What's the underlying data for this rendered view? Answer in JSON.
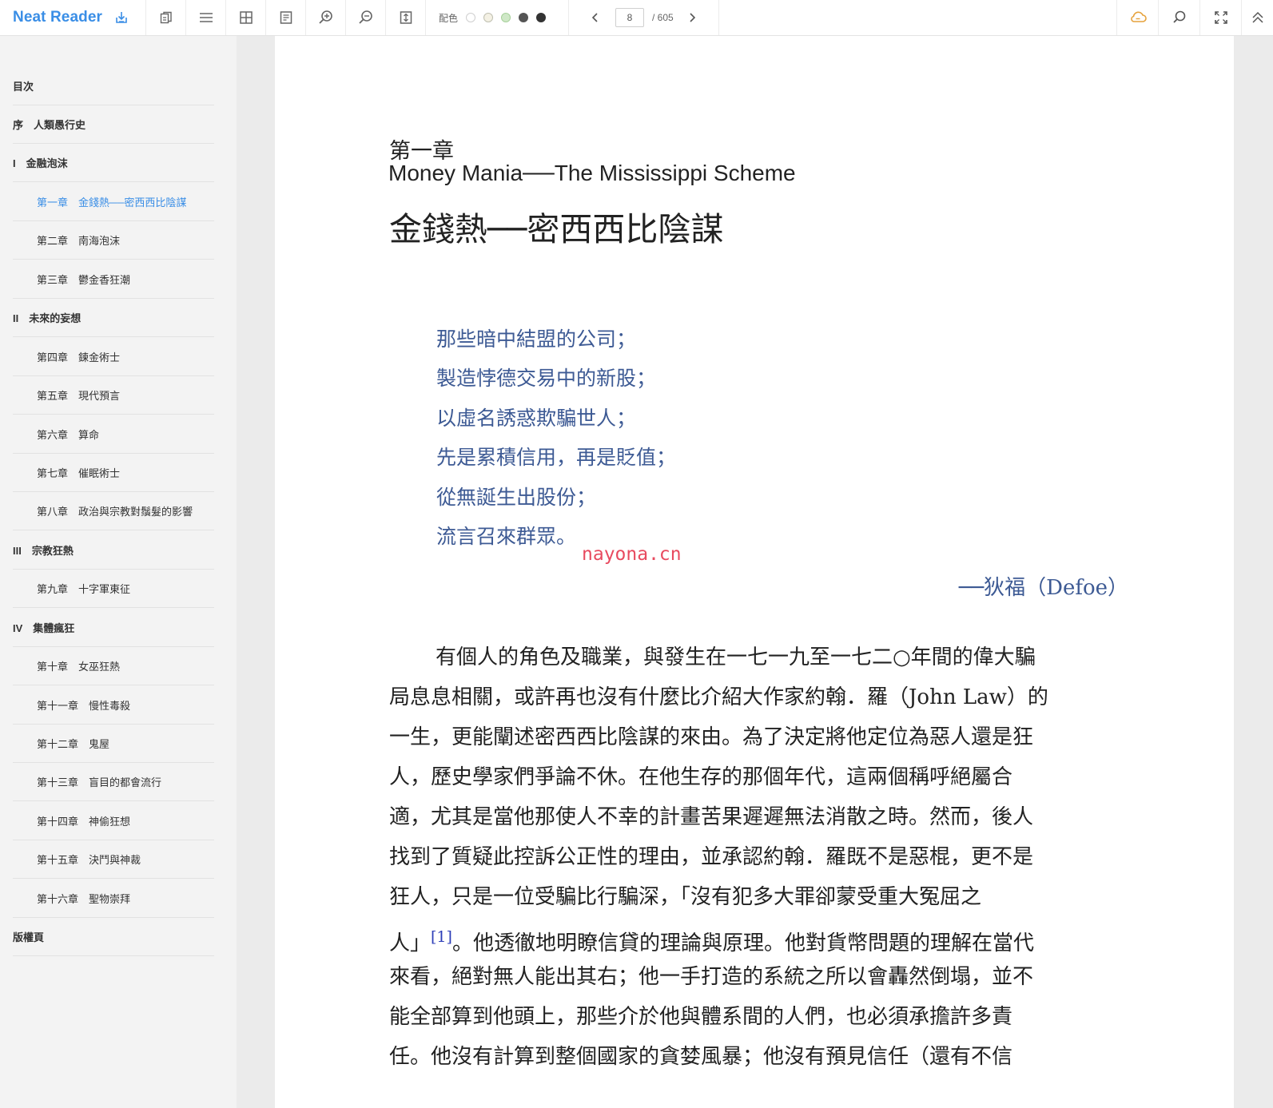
{
  "app": {
    "title": "Neat Reader",
    "accent_color": "#3a8ee6"
  },
  "toolbar": {
    "icons": [
      "import-icon",
      "copy-icon",
      "menu-icon",
      "grid-icon",
      "notes-icon",
      "zoom-in-icon",
      "zoom-out-icon",
      "fit-page-icon"
    ],
    "palette_label": "配色",
    "palette_colors": [
      "#ffffff",
      "#f4f1e4",
      "#cfe8c7",
      "#555555",
      "#333333"
    ],
    "page_current": "8",
    "page_total": "/ 605",
    "right_icons": [
      "cloud-sync-icon",
      "search-icon",
      "fullscreen-icon",
      "collapse-up-icon"
    ]
  },
  "toc": {
    "items": [
      {
        "label": "目次",
        "kind": "part"
      },
      {
        "label": "序　人類愚行史",
        "kind": "part"
      },
      {
        "label": "I　金融泡沫",
        "kind": "part"
      },
      {
        "label": "第一章　金錢熱──密西西比陰謀",
        "kind": "chapter",
        "active": true
      },
      {
        "label": "第二章　南海泡沫",
        "kind": "chapter"
      },
      {
        "label": "第三章　鬱金香狂潮",
        "kind": "chapter"
      },
      {
        "label": "II　未來的妄想",
        "kind": "part"
      },
      {
        "label": "第四章　鍊金術士",
        "kind": "chapter"
      },
      {
        "label": "第五章　現代預言",
        "kind": "chapter"
      },
      {
        "label": "第六章　算命",
        "kind": "chapter"
      },
      {
        "label": "第七章　催眠術士",
        "kind": "chapter"
      },
      {
        "label": "第八章　政治與宗教對鬚髮的影響",
        "kind": "chapter"
      },
      {
        "label": "III　宗教狂熱",
        "kind": "part"
      },
      {
        "label": "第九章　十字軍東征",
        "kind": "chapter"
      },
      {
        "label": "IV　集體瘋狂",
        "kind": "part"
      },
      {
        "label": "第十章　女巫狂熱",
        "kind": "chapter"
      },
      {
        "label": "第十一章　慢性毒殺",
        "kind": "chapter"
      },
      {
        "label": "第十二章　鬼屋",
        "kind": "chapter"
      },
      {
        "label": "第十三章　盲目的都會流行",
        "kind": "chapter"
      },
      {
        "label": "第十四章　神偷狂想",
        "kind": "chapter"
      },
      {
        "label": "第十五章　決鬥與神裁",
        "kind": "chapter"
      },
      {
        "label": "第十六章　聖物崇拜",
        "kind": "chapter"
      },
      {
        "label": "版權頁",
        "kind": "part"
      }
    ]
  },
  "content": {
    "chapter_number": "第一章",
    "chapter_title_en": "Money Mania──The Mississippi Scheme",
    "chapter_title_zh": "金錢熱──密西西比陰謀",
    "verse": [
      "那些暗中結盟的公司；",
      "製造悖德交易中的新股；",
      "以虛名誘惑欺騙世人；",
      "先是累積信用，再是貶值；",
      "從無誕生出股份；",
      "流言召來群眾。"
    ],
    "watermark": "nayona.cn",
    "attribution": "──狄福（Defoe）",
    "body_lines": [
      "有個人的角色及職業，與發生在一七一九至一七二○年間的偉大騙",
      "局息息相關，或許再也沒有什麼比介紹大作家約翰．羅（John Law）的",
      "一生，更能闡述密西西比陰謀的來由。為了決定將他定位為惡人還是狂",
      "人，歷史學家們爭論不休。在他生存的那個年代，這兩個稱呼絕屬合",
      "適，尤其是當他那使人不幸的計畫苦果遲遲無法消散之時。然而，後人",
      "找到了質疑此控訴公正性的理由，並承認約翰．羅既不是惡棍，更不是",
      "狂人，只是一位受騙比行騙深，「沒有犯多大罪卻蒙受重大冤屈之",
      "人」",
      "來看，絕對無人能出其右；他一手打造的系統之所以會轟然倒塌，並不",
      "能全部算到他頭上，那些介於他與體系間的人們，也必須承擔許多責",
      "任。他沒有計算到整個國家的貪婪風暴；他沒有預見信任（還有不信"
    ],
    "footnote_ref": "[1]",
    "line8_rest": "。他透徹地明瞭信貸的理論與原理。他對貨幣問題的理解在當代"
  }
}
